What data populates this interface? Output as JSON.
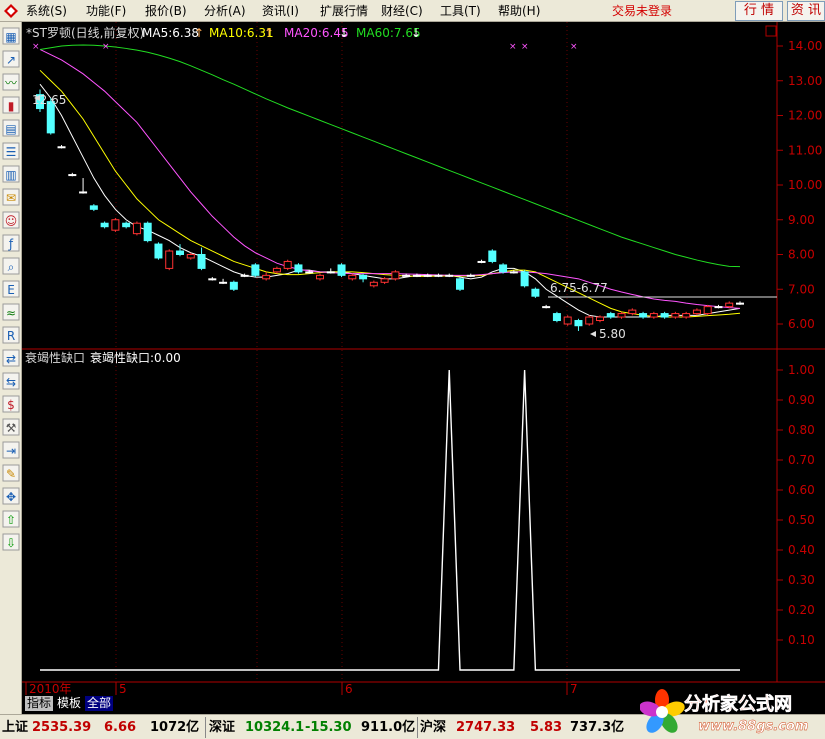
{
  "menu": [
    {
      "label": "系统(S)"
    },
    {
      "label": "功能(F)"
    },
    {
      "label": "报价(B)"
    },
    {
      "label": "分析(A)"
    },
    {
      "label": "资讯(I)"
    },
    {
      "label": "扩展行情"
    },
    {
      "label": "财经(C)"
    },
    {
      "label": "工具(T)"
    },
    {
      "label": "帮助(H)"
    }
  ],
  "login_status": "交易未登录",
  "buttons": {
    "quote": "行 情",
    "news": "资 讯"
  },
  "toolbar_icons": [
    "chart-icon",
    "line-chart-icon",
    "trend-icon",
    "candlestick-icon",
    "table-icon",
    "list-icon",
    "report-icon",
    "mail-icon",
    "people-icon",
    "formula-icon",
    "search-icon",
    "etf-icon",
    "indicator-icon",
    "rsi-icon",
    "switch-icon",
    "exchange-icon",
    "money-icon",
    "tools-icon",
    "export-icon",
    "pen-icon",
    "move-icon",
    "up-arrow-icon",
    "down-arrow-icon"
  ],
  "colors": {
    "ma5": "#ffffff",
    "ma10": "#ffff00",
    "ma20": "#ff55ff",
    "ma60": "#22dd22",
    "up_candle": "#ff3232",
    "down_candle": "#54ffff",
    "axis": "#b00000",
    "price_text": "#c80000"
  },
  "main_panel": {
    "title": "*ST罗顿(日线,前复权)",
    "ma": [
      {
        "label": "MA5:6.38",
        "arrow": "↑"
      },
      {
        "label": "MA10:6.31",
        "arrow": "↑"
      },
      {
        "label": "MA20:6.45",
        "arrow": "↓"
      },
      {
        "label": "MA60:7.65",
        "arrow": "↓"
      }
    ],
    "annotations": {
      "high": "12.65",
      "low": "5.80",
      "range": "6.75-6.77"
    }
  },
  "sub_panel": {
    "title": "衰竭性缺口",
    "label": "衰竭性缺口:0.00"
  },
  "tabs": [
    {
      "label": "指标"
    },
    {
      "label": "模板"
    },
    {
      "label": "全部"
    }
  ],
  "status": {
    "sh": {
      "name": "上证",
      "value": "2535.39",
      "change": "6.66",
      "amount": "1072亿"
    },
    "sz": {
      "name": "深证",
      "value": "10324.1",
      "change": "-15.30",
      "amount": "911.0亿"
    },
    "hs": {
      "name": "沪深",
      "value": "2747.33",
      "change": "5.83",
      "amount": "737.3亿"
    }
  },
  "brand": {
    "name": "分析家公式网",
    "url": "www.88gs.com"
  },
  "chart_data": [
    {
      "type": "line",
      "title": "*ST罗顿(日线,前复权)",
      "y_ticks": [
        "14.00",
        "13.00",
        "12.00",
        "11.00",
        "10.00",
        "9.00",
        "8.00",
        "7.00",
        "6.00"
      ],
      "ylim": [
        5.5,
        14.2
      ],
      "x_ticks": [
        "2010年",
        "5",
        "6",
        "7"
      ],
      "candles": [
        {
          "o": 12.6,
          "c": 12.2,
          "h": 12.75,
          "l": 12.1
        },
        {
          "o": 12.4,
          "c": 11.5,
          "h": 12.5,
          "l": 11.45
        },
        {
          "o": 11.1,
          "c": 11.1,
          "h": 11.15,
          "l": 11.05
        },
        {
          "o": 10.3,
          "c": 10.3,
          "h": 10.35,
          "l": 10.25
        },
        {
          "o": 9.8,
          "c": 9.8,
          "h": 10.2,
          "l": 9.75
        },
        {
          "o": 9.4,
          "c": 9.3,
          "h": 9.45,
          "l": 9.25
        },
        {
          "o": 8.9,
          "c": 8.8,
          "h": 8.95,
          "l": 8.75
        },
        {
          "o": 8.7,
          "c": 9.0,
          "h": 9.05,
          "l": 8.65
        },
        {
          "o": 8.9,
          "c": 8.8,
          "h": 8.95,
          "l": 8.75
        },
        {
          "o": 8.6,
          "c": 8.9,
          "h": 8.95,
          "l": 8.55
        },
        {
          "o": 8.9,
          "c": 8.4,
          "h": 8.95,
          "l": 8.35
        },
        {
          "o": 8.3,
          "c": 7.9,
          "h": 8.35,
          "l": 7.85
        },
        {
          "o": 7.6,
          "c": 8.1,
          "h": 8.15,
          "l": 7.55
        },
        {
          "o": 8.1,
          "c": 8.0,
          "h": 8.3,
          "l": 7.95
        },
        {
          "o": 7.9,
          "c": 8.0,
          "h": 8.05,
          "l": 7.85
        },
        {
          "o": 8.0,
          "c": 7.6,
          "h": 8.2,
          "l": 7.55
        },
        {
          "o": 7.3,
          "c": 7.3,
          "h": 7.35,
          "l": 7.25
        },
        {
          "o": 7.2,
          "c": 7.2,
          "h": 7.3,
          "l": 7.15
        },
        {
          "o": 7.2,
          "c": 7.0,
          "h": 7.25,
          "l": 6.95
        },
        {
          "o": 7.4,
          "c": 7.4,
          "h": 7.45,
          "l": 7.35
        },
        {
          "o": 7.7,
          "c": 7.4,
          "h": 7.75,
          "l": 7.35
        },
        {
          "o": 7.3,
          "c": 7.4,
          "h": 7.5,
          "l": 7.25
        },
        {
          "o": 7.5,
          "c": 7.6,
          "h": 7.65,
          "l": 7.45
        },
        {
          "o": 7.6,
          "c": 7.8,
          "h": 7.85,
          "l": 7.55
        },
        {
          "o": 7.7,
          "c": 7.5,
          "h": 7.75,
          "l": 7.45
        },
        {
          "o": 7.5,
          "c": 7.5,
          "h": 7.55,
          "l": 7.45
        },
        {
          "o": 7.3,
          "c": 7.4,
          "h": 7.45,
          "l": 7.25
        },
        {
          "o": 7.5,
          "c": 7.5,
          "h": 7.6,
          "l": 7.45
        },
        {
          "o": 7.7,
          "c": 7.4,
          "h": 7.75,
          "l": 7.35
        },
        {
          "o": 7.3,
          "c": 7.4,
          "h": 7.45,
          "l": 7.25
        },
        {
          "o": 7.4,
          "c": 7.3,
          "h": 7.45,
          "l": 7.2
        },
        {
          "o": 7.1,
          "c": 7.2,
          "h": 7.25,
          "l": 7.05
        },
        {
          "o": 7.2,
          "c": 7.3,
          "h": 7.35,
          "l": 7.15
        },
        {
          "o": 7.3,
          "c": 7.5,
          "h": 7.55,
          "l": 7.25
        },
        {
          "o": 7.4,
          "c": 7.4,
          "h": 7.45,
          "l": 7.35
        },
        {
          "o": 7.4,
          "c": 7.4,
          "h": 7.45,
          "l": 7.35
        },
        {
          "o": 7.4,
          "c": 7.4,
          "h": 7.45,
          "l": 7.35
        },
        {
          "o": 7.4,
          "c": 7.4,
          "h": 7.45,
          "l": 7.35
        },
        {
          "o": 7.4,
          "c": 7.4,
          "h": 7.45,
          "l": 7.35
        },
        {
          "o": 7.3,
          "c": 7.0,
          "h": 7.35,
          "l": 6.95
        },
        {
          "o": 7.4,
          "c": 7.4,
          "h": 7.45,
          "l": 7.35
        },
        {
          "o": 7.8,
          "c": 7.8,
          "h": 7.85,
          "l": 7.75
        },
        {
          "o": 8.1,
          "c": 7.8,
          "h": 8.15,
          "l": 7.75
        },
        {
          "o": 7.7,
          "c": 7.5,
          "h": 7.75,
          "l": 7.45
        },
        {
          "o": 7.5,
          "c": 7.5,
          "h": 7.55,
          "l": 7.45
        },
        {
          "o": 7.5,
          "c": 7.1,
          "h": 7.55,
          "l": 7.05
        },
        {
          "o": 7.0,
          "c": 6.8,
          "h": 7.05,
          "l": 6.75
        },
        {
          "o": 6.5,
          "c": 6.5,
          "h": 6.55,
          "l": 6.45
        },
        {
          "o": 6.3,
          "c": 6.1,
          "h": 6.35,
          "l": 6.05
        },
        {
          "o": 6.0,
          "c": 6.2,
          "h": 6.25,
          "l": 5.95
        },
        {
          "o": 6.1,
          "c": 5.95,
          "h": 6.15,
          "l": 5.8
        },
        {
          "o": 6.0,
          "c": 6.2,
          "h": 6.25,
          "l": 5.95
        },
        {
          "o": 6.1,
          "c": 6.2,
          "h": 6.25,
          "l": 6.05
        },
        {
          "o": 6.3,
          "c": 6.2,
          "h": 6.35,
          "l": 6.15
        },
        {
          "o": 6.2,
          "c": 6.3,
          "h": 6.35,
          "l": 6.15
        },
        {
          "o": 6.3,
          "c": 6.4,
          "h": 6.45,
          "l": 6.25
        },
        {
          "o": 6.3,
          "c": 6.2,
          "h": 6.35,
          "l": 6.15
        },
        {
          "o": 6.2,
          "c": 6.3,
          "h": 6.35,
          "l": 6.15
        },
        {
          "o": 6.3,
          "c": 6.2,
          "h": 6.35,
          "l": 6.15
        },
        {
          "o": 6.2,
          "c": 6.3,
          "h": 6.35,
          "l": 6.15
        },
        {
          "o": 6.2,
          "c": 6.3,
          "h": 6.35,
          "l": 6.15
        },
        {
          "o": 6.3,
          "c": 6.4,
          "h": 6.45,
          "l": 6.25
        },
        {
          "o": 6.3,
          "c": 6.5,
          "h": 6.55,
          "l": 6.25
        },
        {
          "o": 6.5,
          "c": 6.5,
          "h": 6.55,
          "l": 6.45
        },
        {
          "o": 6.5,
          "c": 6.6,
          "h": 6.65,
          "l": 6.45
        },
        {
          "o": 6.6,
          "c": 6.6,
          "h": 6.65,
          "l": 6.55
        }
      ],
      "series": [
        {
          "name": "MA5",
          "values": [
            12.9,
            12.5,
            12.0,
            11.4,
            10.8,
            10.2,
            9.7,
            9.3,
            9.0,
            8.8,
            8.7,
            8.55,
            8.4,
            8.2,
            8.05,
            7.95,
            7.8,
            7.65,
            7.5,
            7.4,
            7.35,
            7.35,
            7.4,
            7.45,
            7.55,
            7.55,
            7.5,
            7.5,
            7.5,
            7.45,
            7.4,
            7.35,
            7.3,
            7.3,
            7.35,
            7.4,
            7.4,
            7.4,
            7.4,
            7.35,
            7.3,
            7.35,
            7.5,
            7.6,
            7.6,
            7.5,
            7.3,
            7.0,
            6.8,
            6.6,
            6.4,
            6.25,
            6.2,
            6.2,
            6.2,
            6.2,
            6.2,
            6.2,
            6.25,
            6.25,
            6.25,
            6.25,
            6.3,
            6.35,
            6.4,
            6.45
          ]
        },
        {
          "name": "MA10",
          "values": [
            13.3,
            13.0,
            12.7,
            12.3,
            11.9,
            11.4,
            10.9,
            10.4,
            10.0,
            9.6,
            9.3,
            9.0,
            8.8,
            8.6,
            8.4,
            8.25,
            8.1,
            7.95,
            7.8,
            7.7,
            7.6,
            7.5,
            7.45,
            7.42,
            7.42,
            7.45,
            7.48,
            7.5,
            7.5,
            7.5,
            7.48,
            7.45,
            7.42,
            7.4,
            7.38,
            7.37,
            7.37,
            7.38,
            7.38,
            7.38,
            7.38,
            7.4,
            7.45,
            7.5,
            7.55,
            7.55,
            7.5,
            7.35,
            7.2,
            7.05,
            6.9,
            6.75,
            6.6,
            6.45,
            6.35,
            6.3,
            6.25,
            6.22,
            6.2,
            6.2,
            6.2,
            6.22,
            6.24,
            6.26,
            6.28,
            6.31
          ]
        },
        {
          "name": "MA20",
          "values": [
            13.9,
            13.75,
            13.6,
            13.4,
            13.2,
            12.95,
            12.7,
            12.4,
            12.1,
            11.8,
            11.4,
            11.0,
            10.6,
            10.2,
            9.8,
            9.45,
            9.1,
            8.8,
            8.5,
            8.25,
            8.05,
            7.9,
            7.75,
            7.65,
            7.58,
            7.53,
            7.5,
            7.48,
            7.46,
            7.45,
            7.45,
            7.45,
            7.45,
            7.45,
            7.44,
            7.43,
            7.42,
            7.41,
            7.4,
            7.4,
            7.4,
            7.42,
            7.45,
            7.48,
            7.5,
            7.5,
            7.48,
            7.45,
            7.4,
            7.35,
            7.3,
            7.2,
            7.1,
            7.0,
            6.92,
            6.85,
            6.78,
            6.72,
            6.68,
            6.65,
            6.6,
            6.56,
            6.53,
            6.5,
            6.47,
            6.45
          ]
        },
        {
          "name": "MA60",
          "values": [
            13.9,
            13.95,
            14.0,
            14.02,
            14.03,
            14.02,
            14.0,
            13.97,
            13.93,
            13.88,
            13.82,
            13.74,
            13.65,
            13.55,
            13.43,
            13.3,
            13.17,
            13.03,
            12.9,
            12.76,
            12.62,
            12.48,
            12.35,
            12.22,
            12.1,
            11.98,
            11.86,
            11.74,
            11.62,
            11.5,
            11.38,
            11.26,
            11.14,
            11.02,
            10.9,
            10.78,
            10.66,
            10.54,
            10.42,
            10.3,
            10.18,
            10.06,
            9.94,
            9.82,
            9.7,
            9.58,
            9.46,
            9.34,
            9.22,
            9.1,
            8.98,
            8.86,
            8.74,
            8.62,
            8.5,
            8.4,
            8.3,
            8.2,
            8.1,
            8.0,
            7.92,
            7.84,
            7.77,
            7.71,
            7.66,
            7.65
          ]
        }
      ]
    },
    {
      "type": "line",
      "title": "衰竭性缺口",
      "y_ticks": [
        "1.00",
        "0.90",
        "0.80",
        "0.70",
        "0.60",
        "0.50",
        "0.40",
        "0.30",
        "0.20",
        "0.10"
      ],
      "ylim": [
        0,
        1.05
      ],
      "series": [
        {
          "name": "衰竭性缺口",
          "values": [
            0,
            0,
            0,
            0,
            0,
            0,
            0,
            0,
            0,
            0,
            0,
            0,
            0,
            0,
            0,
            0,
            0,
            0,
            0,
            0,
            0,
            0,
            0,
            0,
            0,
            0,
            0,
            0,
            0,
            0,
            0,
            0,
            0,
            0,
            0,
            0,
            0,
            0,
            0,
            0,
            0,
            0,
            0,
            0,
            0,
            0,
            0,
            0,
            0,
            0,
            0,
            0,
            0,
            0,
            0,
            0,
            0,
            0,
            0,
            0,
            0,
            0,
            0,
            0,
            0,
            0
          ]
        },
        {
          "name": "spikes",
          "values": [
            0,
            0,
            0,
            0,
            0,
            0,
            0,
            0,
            0,
            0,
            0,
            0,
            0,
            0,
            0,
            0,
            0,
            0,
            0,
            0,
            0,
            0,
            0,
            0,
            0,
            0,
            0,
            0,
            0,
            0,
            0,
            0,
            0,
            0,
            0,
            0,
            0,
            0,
            1,
            0,
            0,
            0,
            0,
            0,
            0,
            1,
            0,
            0,
            0,
            0,
            0,
            0,
            0,
            0,
            0,
            0,
            0,
            0,
            0,
            0,
            0,
            0,
            0,
            0,
            0,
            0
          ]
        }
      ]
    }
  ]
}
